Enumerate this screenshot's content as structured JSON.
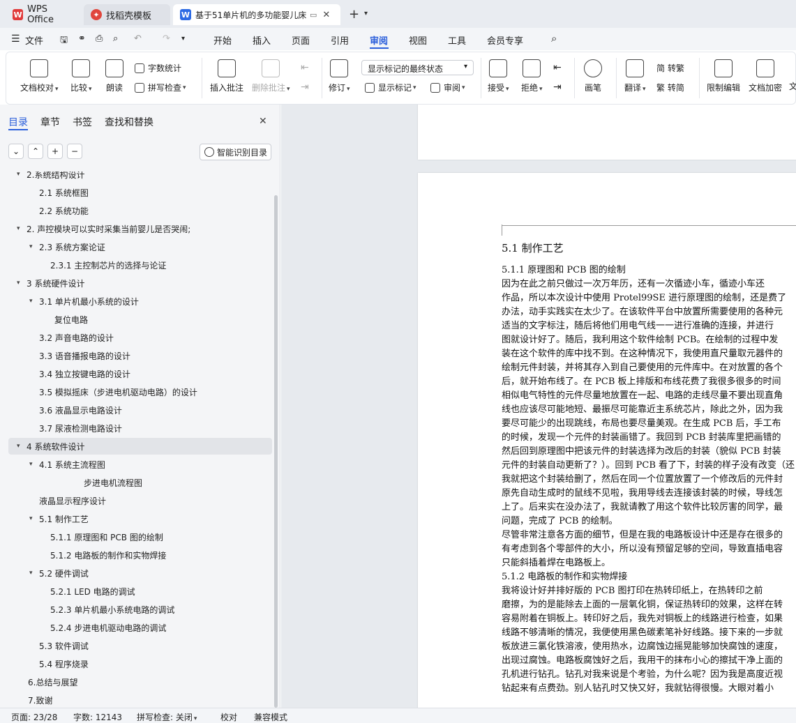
{
  "tabs": [
    {
      "label": "WPS Office"
    },
    {
      "label": "找稻壳模板"
    },
    {
      "label": "基于51单片机的多功能婴儿床"
    }
  ],
  "menu": {
    "file": "文件",
    "items": [
      "开始",
      "插入",
      "页面",
      "引用",
      "审阅",
      "视图",
      "工具",
      "会员专享"
    ],
    "active": "审阅"
  },
  "ribbon": {
    "doc_check": "文档校对",
    "compare": "比较",
    "read_aloud": "朗读",
    "word_count": "字数统计",
    "spell_check": "拼写检查",
    "insert_comment": "插入批注",
    "delete_comment": "删除批注",
    "revise": "修订",
    "display_state": "显示标记的最终状态",
    "show_markup": "显示标记",
    "review": "审阅",
    "accept": "接受",
    "reject": "拒绝",
    "pen": "画笔",
    "translate": "翻译",
    "to_traditional": "转繁",
    "to_simplified": "繁 转简",
    "restrict_edit": "限制编辑",
    "doc_encrypt": "文档加密",
    "wen": "文"
  },
  "nav": {
    "tabs": [
      "目录",
      "章节",
      "书签",
      "查找和替换"
    ],
    "smart_toc": "智能识别目录",
    "toc": [
      {
        "text": "2.系统结构设计",
        "arrow": "▾"
      },
      {
        "text": "2.1  系统框图",
        "arrow": ""
      },
      {
        "text": "2.2  系统功能",
        "arrow": ""
      },
      {
        "text": "2. 声控模块可以实时采集当前婴儿是否哭闹;",
        "arrow": "▾"
      },
      {
        "text": "2.3  系统方案论证",
        "arrow": "▾"
      },
      {
        "text": "2.3.1  主控制芯片的选择与论证",
        "arrow": ""
      },
      {
        "text": "3 系统硬件设计",
        "arrow": "▾"
      },
      {
        "text": "3.1  单片机最小系统的设计",
        "arrow": "▾"
      },
      {
        "text": "复位电路",
        "arrow": ""
      },
      {
        "text": "3.2  声音电路的设计",
        "arrow": ""
      },
      {
        "text": "3.3 语音播报电路的设计",
        "arrow": ""
      },
      {
        "text": "3.4  独立按键电路的设计",
        "arrow": ""
      },
      {
        "text": "3.5  模拟摇床（步进电机驱动电路）的设计",
        "arrow": ""
      },
      {
        "text": "3.6  液晶显示电路设计",
        "arrow": ""
      },
      {
        "text": "3.7 尿液检测电路设计",
        "arrow": ""
      },
      {
        "text": "4 系统软件设计",
        "arrow": "▾"
      },
      {
        "text": "4.1  系统主流程图",
        "arrow": "▾"
      },
      {
        "text": "步进电机流程图",
        "arrow": ""
      },
      {
        "text": "液晶显示程序设计",
        "arrow": ""
      },
      {
        "text": "5.1  制作工艺",
        "arrow": "▾"
      },
      {
        "text": "5.1.1 原理图和 PCB 图的绘制",
        "arrow": ""
      },
      {
        "text": "5.1.2  电路板的制作和实物焊接",
        "arrow": ""
      },
      {
        "text": "5.2  硬件调试",
        "arrow": "▾"
      },
      {
        "text": "5.2.1 LED 电路的调试",
        "arrow": ""
      },
      {
        "text": "5.2.3 单片机最小系统电路的调试",
        "arrow": ""
      },
      {
        "text": "5.2.4 步进电机驱动电路的调试",
        "arrow": ""
      },
      {
        "text": "5.3  软件调试",
        "arrow": ""
      },
      {
        "text": "5.4  程序烧录",
        "arrow": ""
      },
      {
        "text": "6.总结与展望",
        "arrow": ""
      },
      {
        "text": "7.致谢",
        "arrow": ""
      }
    ]
  },
  "doc": {
    "page_number": "23",
    "lines": [
      "5.1  制作工艺",
      "5.1.1 原理图和 PCB 图的绘制",
      "      因为在此之前只做过一次万年历，还有一次循迹小车，循迹小车还",
      "作品，所以本次设计中使用 Protel99SE 进行原理图的绘制，还是费了",
      "办法，动手实践实在太少了。在该软件平台中放置所需要使用的各种元",
      "适当的文字标注，随后将他们用电气线一一进行准确的连接，并进行",
      "图就设计好了。随后，我利用这个软件绘制 PCB。在绘制的过程中发",
      "装在这个软件的库中找不到。在这种情况下，我使用直尺量取元器件的",
      "绘制元件封装，并将其存入到自己要使用的元件库中。在对放置的各个",
      "后，就开始布线了。在 PCB 板上排版和布线花费了我很多很多的时间",
      "相似电气特性的元件尽量地放置在一起、电路的走线尽量不要出现直角",
      "线也应该尽可能地短、最振尽可能靠近主系统芯片，除此之外，因为我",
      "要尽可能少的出现跳线，布局也要尽量美观。在生成 PCB 后，手工布",
      "的时候，发现一个元件的封装画错了。我回到 PCB 封装库里把画错的",
      "然后回到原理图中把该元件的封装选择为改后的封装（貌似 PCB 封装",
      "元件的封装自动更新了？）。回到 PCB 看了下，封装的样子没有改变（还",
      "我就把这个封装给删了，然后在同一个位置放置了一个修改后的元件封",
      "原先自动生成时的鼠线不见啦，我用导线去连接该封装的时候，导线怎",
      "上了。后来实在没办法了，我就请教了用这个软件比较厉害的同学，最",
      "问题，完成了 PCB 的绘制。",
      "尽管非常注意各方面的细节，但是在我的电路板设计中还是存在很多的",
      "有考虑到各个零部件的大小，所以没有预留足够的空间，导致直插电容",
      "只能斜插着焊在电路板上。",
      "5.1.2  电路板的制作和实物焊接",
      "      我将设计好并排好版的 PCB 图打印在热转印纸上，在热转印之前",
      "磨擦，为的是能除去上面的一层氧化铜，保证热转印的效果，这样在转",
      "容易附着在铜板上。转印好之后，我先对铜板上的线路进行检查，如果",
      "线路不够清晰的情况，我便使用黑色碳素笔补好线路。接下来的一步就",
      "板放进三氯化铁溶液，使用热水，边腐蚀边摇晃能够加快腐蚀的速度，",
      "出现过腐蚀。电路板腐蚀好之后，我用干的抹布小心的擦拭干净上面的",
      "孔机进行钻孔。钻孔对我来说是个考验，为什么呢？因为我是高度近视",
      "钻起来有点费劲。别人钻孔时又快又好，我就钻得很慢。大眼对着小"
    ]
  },
  "status": {
    "page": "页面: 23/28",
    "words": "字数: 12143",
    "spell": "拼写检查: 关闭",
    "proof": "校对",
    "compat": "兼容模式"
  },
  "colors": {
    "accent": "#2b5fdb",
    "wps_red": "#e03a3a",
    "docer_red": "#e0463c",
    "doc_blue": "#2d6be4"
  }
}
